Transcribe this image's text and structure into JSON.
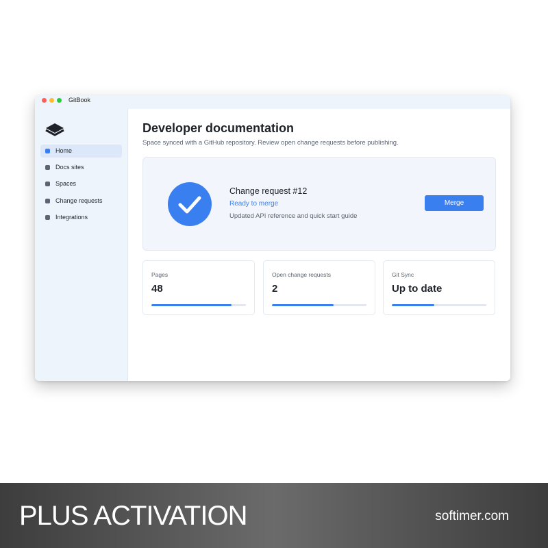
{
  "window": {
    "app_title": "GitBook"
  },
  "sidebar": {
    "items": [
      {
        "label": "Home",
        "active": true
      },
      {
        "label": "Docs sites",
        "active": false
      },
      {
        "label": "Spaces",
        "active": false
      },
      {
        "label": "Change requests",
        "active": false
      },
      {
        "label": "Integrations",
        "active": false
      }
    ]
  },
  "main": {
    "title": "Developer documentation",
    "subtitle": "Space synced with a GitHub repository. Review open change requests before publishing.",
    "change_request": {
      "icon": "check-icon",
      "title": "Change request #12",
      "status": "Ready to merge",
      "description": "Updated API reference and quick start guide",
      "merge_label": "Merge"
    },
    "stats": [
      {
        "label": "Pages",
        "value": "48",
        "progress": 0.85
      },
      {
        "label": "Open change requests",
        "value": "2",
        "progress": 0.65
      },
      {
        "label": "Git Sync",
        "value": "Up to date",
        "progress": 0.45
      }
    ]
  },
  "banner": {
    "title": "PLUS ACTIVATION",
    "site": "softimer.com"
  },
  "colors": {
    "accent": "#3a7ff0",
    "sidebar_bg": "#eef4fb",
    "card_bg": "#f2f6fc"
  }
}
